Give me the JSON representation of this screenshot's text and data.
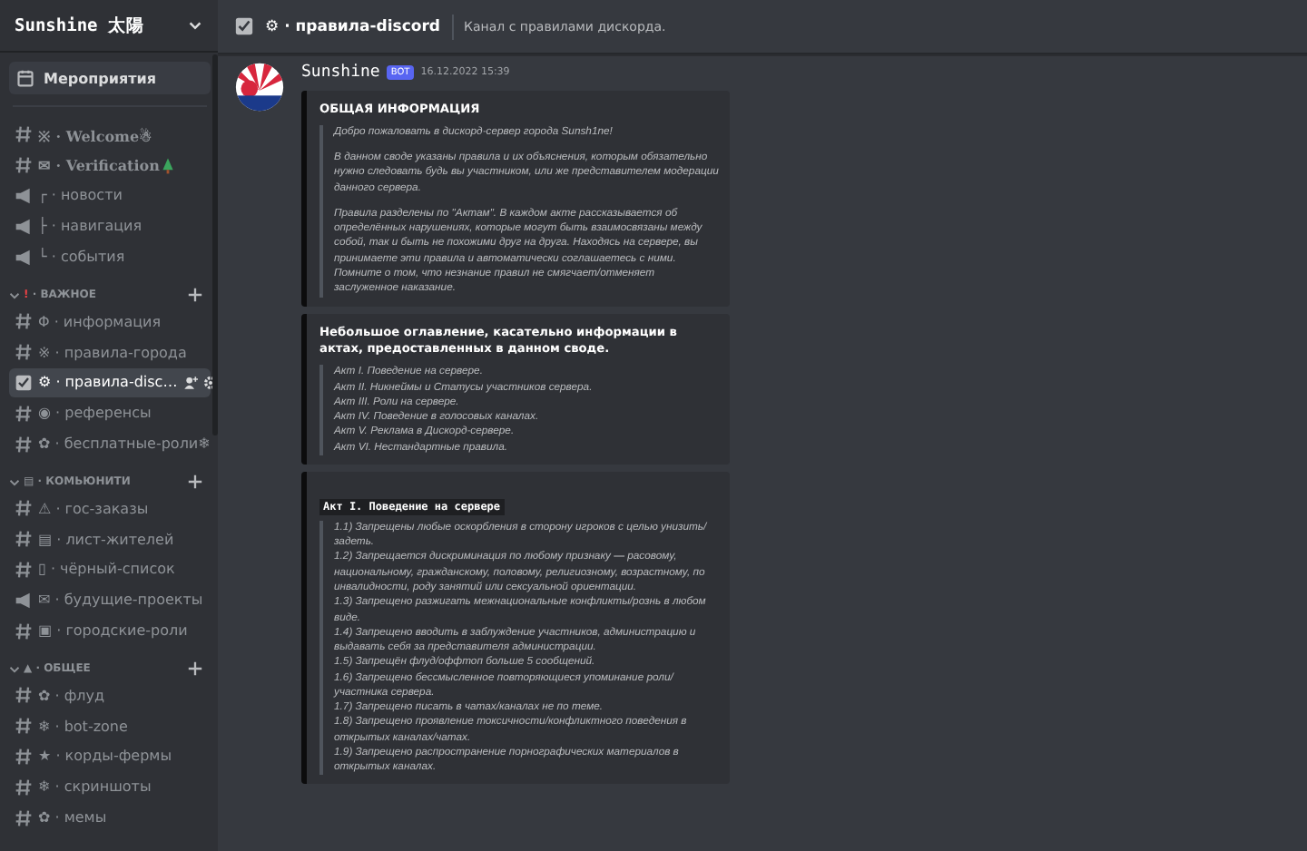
{
  "server": {
    "name": "Sunshine 太陽"
  },
  "events": {
    "label": "Мероприятия",
    "selected": false
  },
  "channels": [
    {
      "kind": "text",
      "prefix": "※ ·",
      "name": "Welcome",
      "fancy": true,
      "suffix": "☃",
      "selected": false
    },
    {
      "kind": "text",
      "prefix": "✉ ·",
      "name": "Verification",
      "fancy": true,
      "emoji": {
        "kind": "tree"
      },
      "selected": false
    },
    {
      "kind": "announcement",
      "prefix": "┌ ·",
      "name": "новости",
      "selected": false
    },
    {
      "kind": "announcement",
      "prefix": "├ ·",
      "name": "навигация",
      "selected": false
    },
    {
      "kind": "announcement",
      "prefix": "└ ·",
      "name": "события",
      "selected": false
    }
  ],
  "categories": [
    {
      "mark": "!",
      "name": "· ВАЖНОЕ",
      "channels": [
        {
          "kind": "text",
          "prefix": "Φ ·",
          "name": "информация",
          "selected": false
        },
        {
          "kind": "text",
          "prefix": "※ ·",
          "name": "правила-города",
          "selected": false
        },
        {
          "kind": "rules",
          "prefix": "⚙ ·",
          "name": "правила-disc…",
          "selected": true
        },
        {
          "kind": "text",
          "prefix": "◉ ·",
          "name": "референсы",
          "selected": false
        },
        {
          "kind": "text",
          "prefix": "✿ ·",
          "name": "бесплатные-роли",
          "suffix": "❄",
          "selected": false
        }
      ]
    },
    {
      "mark": "▤",
      "name": "· КОМЬЮНИТИ",
      "channels": [
        {
          "kind": "text",
          "prefix": "⚠ ·",
          "name": "гос-заказы",
          "selected": false
        },
        {
          "kind": "text",
          "prefix": "▤ ·",
          "name": "лист-жителей",
          "selected": false
        },
        {
          "kind": "text",
          "prefix": "▯ ·",
          "name": "чёрный-список",
          "selected": false
        },
        {
          "kind": "announcement",
          "prefix": "✉ ·",
          "name": "будущие-проекты",
          "selected": false
        },
        {
          "kind": "text",
          "prefix": "▣ ·",
          "name": "городские-роли",
          "selected": false
        }
      ]
    },
    {
      "mark": "▲",
      "name": "· ОБЩЕЕ",
      "channels": [
        {
          "kind": "text",
          "prefix": "✿ ·",
          "name": "флуд",
          "selected": false
        },
        {
          "kind": "text",
          "prefix": "❄ ·",
          "name": "bot-zone",
          "selected": false
        },
        {
          "kind": "text",
          "prefix": "★ ·",
          "name": "корды-фермы",
          "selected": false
        },
        {
          "kind": "text",
          "prefix": "❄ ·",
          "name": "скриншоты",
          "selected": false
        },
        {
          "kind": "text",
          "prefix": "✿ ·",
          "name": "мемы",
          "selected": false
        }
      ]
    }
  ],
  "header": {
    "prefix": "⚙ ·",
    "channel": "правила-discord",
    "topic": "Канал с правилами дискорда."
  },
  "message": {
    "author": "Sunshine",
    "badge": "BOT",
    "time": "16.12.2022 15:39",
    "embeds": [
      {
        "kind": "heading",
        "title": "ОБЩАЯ ИНФОРМАЦИЯ",
        "quote": [
          "Добро пожаловать в дискорд-сервер города Sunsh1ne!",
          "В данном своде указаны правила и их объяснения, которым обязательно нужно следовать будь вы участником, или же представителем модерации данного сервера.",
          "Правила разделены по \"Актам\". В каждом акте рассказывается об определённых нарушениях, которые могут быть взаимосвязаны между собой, так и быть не похожими друг на друга. Находясь на сервере, вы принимаете эти правила и автоматически соглашаетесь с ними. Помните о том, что незнание правил не смягчает/отменяет заслуженное наказание."
        ]
      },
      {
        "kind": "heading",
        "title": "Небольшое оглавление, касательно информации в актах, предоставленных в данном своде.",
        "lines": [
          "Акт I. Поведение на сервере.",
          "Акт II. Никнеймы и Статусы участников сервера.",
          "Акт III. Роли на сервере.",
          "Акт IV. Поведение в голосовых каналах.",
          "Акт V. Реклама в Дискорд-сервере.",
          "Акт VI. Нестандартные правила."
        ]
      },
      {
        "kind": "code",
        "title": "Акт I. Поведение на сервере",
        "lines": [
          "1.1) Запрещены любые оскорбления в сторону игроков с целью унизить/задеть.",
          "1.2) Запрещается дискриминация по любому признаку — расовому, национальному, гражданскому, половому, религиозному, возрастному, по инвалидности, роду занятий или сексуальной ориентации.",
          "1.3) Запрещено разжигать межнациональные конфликты/рознь в любом виде.",
          "1.4) Запрещено вводить в заблуждение участников, администрацию и выдавать себя за представителя администрации.",
          "1.5) Запрещён флуд/оффтоп больше 5 сообщений.",
          "1.6) Запрещено бессмысленное повторяющиеся упоминание роли/участника сервера.",
          "1.7) Запрещено писать в чатах/каналах не по теме.",
          "1.8) Запрещено проявление токсичности/конфликтного поведения в открытых каналах/чатах.",
          "1.9) Запрещено распространение порнографических материалов в открытых каналах."
        ]
      }
    ]
  }
}
